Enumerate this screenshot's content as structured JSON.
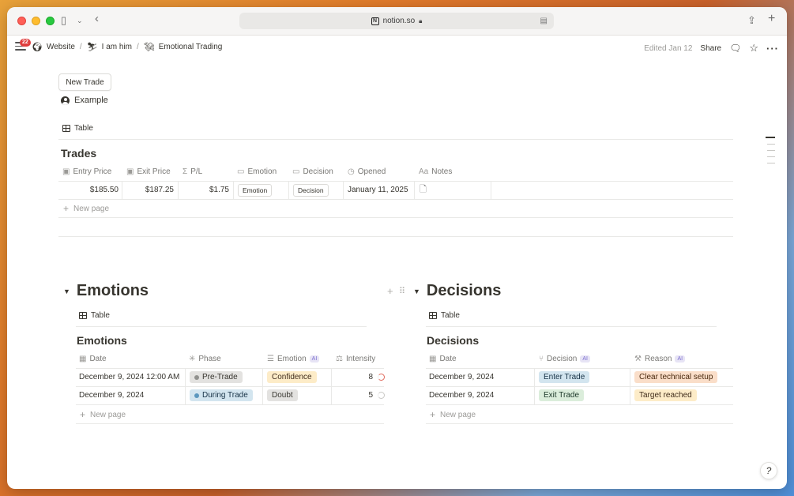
{
  "browser": {
    "url": "notion.so"
  },
  "topbar": {
    "badge_count": "22",
    "breadcrumbs": [
      {
        "label": "Website"
      },
      {
        "label": "I am him"
      },
      {
        "label": "Emotional Trading"
      }
    ],
    "edited": "Edited Jan 12",
    "share": "Share"
  },
  "page": {
    "new_trade_label": "New Trade",
    "example_label": "Example",
    "trades_view_tab": "Table",
    "trades": {
      "title": "Trades",
      "columns": [
        "Entry Price",
        "Exit Price",
        "P/L",
        "Emotion",
        "Decision",
        "Opened",
        "Notes"
      ],
      "rows": [
        {
          "entry": "$185.50",
          "exit": "$187.25",
          "pl": "$1.75",
          "emotion": "Emotion",
          "decision": "Decision",
          "opened": "January 11, 2025"
        }
      ],
      "new_page": "New page"
    },
    "emotions": {
      "heading": "Emotions",
      "view_tab": "Table",
      "title": "Emotions",
      "columns": [
        "Date",
        "Phase",
        "Emotion",
        "Intensity"
      ],
      "ai_tag": "AI",
      "rows": [
        {
          "date": "December 9, 2024 12:00 AM",
          "phase": "Pre-Trade",
          "emotion": "Confidence",
          "intensity": "8"
        },
        {
          "date": "December 9, 2024",
          "phase": "During Trade",
          "emotion": "Doubt",
          "intensity": "5"
        }
      ],
      "new_page": "New page"
    },
    "decisions": {
      "heading": "Decisions",
      "view_tab": "Table",
      "title": "Decisions",
      "columns": [
        "Date",
        "Decision",
        "Reason"
      ],
      "ai_tag": "AI",
      "rows": [
        {
          "date": "December 9, 2024",
          "decision": "Enter Trade",
          "reason": "Clear technical setup"
        },
        {
          "date": "December 9, 2024",
          "decision": "Exit Trade",
          "reason": "Target reached"
        }
      ],
      "new_page": "New page"
    }
  },
  "colors": {
    "accent_red": "#e03e3e",
    "tag_gray": "#e3e2e0",
    "tag_blue": "#d3e5ef",
    "tag_yellow": "#fdecc8",
    "tag_green": "#dbeddb",
    "tag_orange": "#fadec9"
  }
}
